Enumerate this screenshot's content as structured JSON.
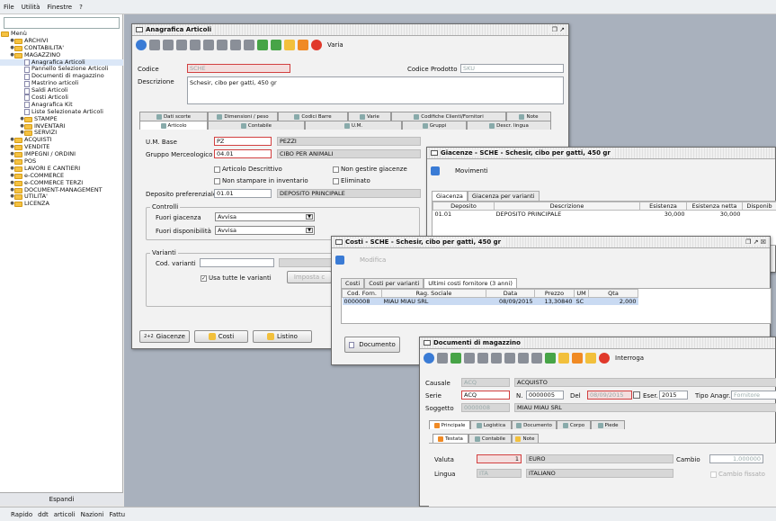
{
  "menubar": {
    "items": [
      "File",
      "Utilità",
      "Finestre",
      "?"
    ]
  },
  "left": {
    "tree": [
      {
        "label": "Menù",
        "kind": "folder",
        "level": 0,
        "exp": ""
      },
      {
        "label": "ARCHIVI",
        "kind": "folder",
        "level": 1,
        "exp": "o-"
      },
      {
        "label": "CONTABILITA'",
        "kind": "folder",
        "level": 1,
        "exp": "o-"
      },
      {
        "label": "MAGAZZINO",
        "kind": "folder",
        "level": 1,
        "exp": "o"
      },
      {
        "label": "Anagrafica Articoli",
        "kind": "doc",
        "level": 2,
        "exp": "",
        "selected": true
      },
      {
        "label": "Pannello Selezione Articoli",
        "kind": "doc",
        "level": 2,
        "exp": ""
      },
      {
        "label": "Documenti di magazzino",
        "kind": "doc",
        "level": 2,
        "exp": ""
      },
      {
        "label": "Mastrino articoli",
        "kind": "doc",
        "level": 2,
        "exp": ""
      },
      {
        "label": "Saldi Articoli",
        "kind": "doc",
        "level": 2,
        "exp": ""
      },
      {
        "label": "Costi Articoli",
        "kind": "doc",
        "level": 2,
        "exp": ""
      },
      {
        "label": "Anagrafica Kit",
        "kind": "doc",
        "level": 2,
        "exp": ""
      },
      {
        "label": "Liste Selezionate Articoli",
        "kind": "doc",
        "level": 2,
        "exp": ""
      },
      {
        "label": "STAMPE",
        "kind": "folder",
        "level": 2,
        "exp": "o-"
      },
      {
        "label": "INVENTARI",
        "kind": "folder",
        "level": 2,
        "exp": "o-"
      },
      {
        "label": "SERVIZI",
        "kind": "folder",
        "level": 2,
        "exp": "o-"
      },
      {
        "label": "ACQUISTI",
        "kind": "folder",
        "level": 1,
        "exp": "o-"
      },
      {
        "label": "VENDITE",
        "kind": "folder",
        "level": 1,
        "exp": "o-"
      },
      {
        "label": "IMPEGNI / ORDINI",
        "kind": "folder",
        "level": 1,
        "exp": "o-"
      },
      {
        "label": "POS",
        "kind": "folder",
        "level": 1,
        "exp": "o-"
      },
      {
        "label": "LAVORI E CANTIERI",
        "kind": "folder",
        "level": 1,
        "exp": "o-"
      },
      {
        "label": "e-COMMERCE",
        "kind": "folder",
        "level": 1,
        "exp": "o-"
      },
      {
        "label": "e-COMMERCE TERZI",
        "kind": "folder",
        "level": 1,
        "exp": "o-"
      },
      {
        "label": "DOCUMENT-MANAGEMENT",
        "kind": "folder",
        "level": 1,
        "exp": "o-"
      },
      {
        "label": "UTILITA'",
        "kind": "folder",
        "level": 1,
        "exp": "o-"
      },
      {
        "label": "LICENZA",
        "kind": "folder",
        "level": 1,
        "exp": "o-"
      }
    ],
    "expand_label": "Espandi"
  },
  "statusbar": {
    "items": [
      "Rapido",
      "ddt",
      "articoli",
      "Nazioni",
      "Fattu"
    ]
  },
  "anagrafica": {
    "title": "Anagrafica Articoli",
    "wc": "❐ ↗",
    "toolbar_label": "Varia",
    "codice_label": "Codice",
    "codice": "SCHE",
    "codice_prodotto_label": "Codice Prodotto",
    "codice_prodotto": "SKU",
    "descrizione_label": "Descrizione",
    "descrizione": "Schesir, cibo per gatti, 450 gr",
    "tabs_row1": [
      "Dati scorte",
      "Dimensioni / peso",
      "Codici Barre",
      "Varie",
      "Codifiche Clienti/Fornitori",
      "Note"
    ],
    "tabs_row2": [
      "Articolo",
      "Contabile",
      "U.M.",
      "Gruppi",
      "Descr. lingua"
    ],
    "um_base_label": "U.M. Base",
    "um_base": "PZ",
    "um_base_desc": "PEZZI",
    "gruppo_label": "Gruppo Merceologico",
    "gruppo": "04.01",
    "gruppo_desc": "CIBO PER ANIMALI",
    "chk_descrittivo": "Articolo Descrittivo",
    "chk_non_gestire": "Non gestire giacenze",
    "chk_non_stampare": "Non stampare in inventario",
    "chk_eliminato": "Eliminato",
    "deposito_label": "Deposito preferenziale",
    "deposito": "01.01",
    "deposito_desc": "DEPOSITO PRINCIPALE",
    "controlli_title": "Controlli",
    "fuori_giacenza_label": "Fuori giacenza",
    "fuori_giacenza": "Avvisa",
    "fuori_disp_label": "Fuori disponibilità",
    "fuori_disp": "Avvisa",
    "varianti_title": "Varianti",
    "cod_varianti_label": "Cod. varianti",
    "usa_varianti": "Usa tutte le varianti",
    "imposta_label": "Imposta c",
    "btn_giacenze": "Giacenze",
    "btn_giacenze_prefix": "2+2",
    "btn_costi": "Costi",
    "btn_listino": "Listino"
  },
  "giacenze": {
    "title": "Giacenze - SCHE - Schesir, cibo per gatti, 450 gr",
    "toolbar_label": "Movimenti",
    "tabs": [
      "Giacenza",
      "Giacenza per varianti"
    ],
    "columns": [
      "Deposito",
      "Descrizione",
      "Esistenza",
      "Esistenza netta",
      "Disponib"
    ],
    "rows": [
      [
        "01.01",
        "DEPOSITO PRINCIPALE",
        "30,000",
        "30,000",
        ""
      ]
    ]
  },
  "costi": {
    "title": "Costi - SCHE - Schesir, cibo per gatti, 450 gr",
    "wc": "❐ ↗ ☒",
    "toolbar_label": "Modifica",
    "tabs": [
      "Costi",
      "Costi per varianti",
      "Ultimi costi fornitore (3 anni)"
    ],
    "columns": [
      "Cod. Forn.",
      "Rag. Sociale",
      "Data",
      "Prezzo",
      "UM",
      "Qta"
    ],
    "rows": [
      [
        "0000008",
        "MIAU MIAU SRL",
        "08/09/2015",
        "13,30840",
        "SC",
        "2,000"
      ]
    ],
    "btn_documento": "Documento"
  },
  "documenti": {
    "title": "Documenti di magazzino",
    "toolbar_label": "Interroga",
    "causale_label": "Causale",
    "causale": "ACQ",
    "causale_desc": "ACQUISTO",
    "serie_label": "Serie",
    "serie": "ACQ",
    "n_label": "N.",
    "numero": "0000005",
    "del_label": "Del",
    "data": "08/09/2015",
    "eser_label": "Eser.",
    "esercizio": "2015",
    "tipo_anagr_label": "Tipo Anagr.",
    "tipo_anagr": "Fornitore",
    "soggetto_label": "Soggetto",
    "soggetto": "0000008",
    "soggetto_desc": "MIAU MIAU SRL",
    "tabs1": [
      "Principale",
      "Logistica",
      "Documento",
      "Corpo",
      "Piede"
    ],
    "tabs2": [
      "Testata",
      "Contabile",
      "Note"
    ],
    "valuta_label": "Valuta",
    "valuta_num": "1",
    "valuta_desc": "EURO",
    "cambio_label": "Cambio",
    "cambio": "1,000000",
    "lingua_label": "Lingua",
    "lingua": "ITA",
    "lingua_desc": "ITALIANO",
    "cambio_fissato": "Cambio fissato"
  }
}
